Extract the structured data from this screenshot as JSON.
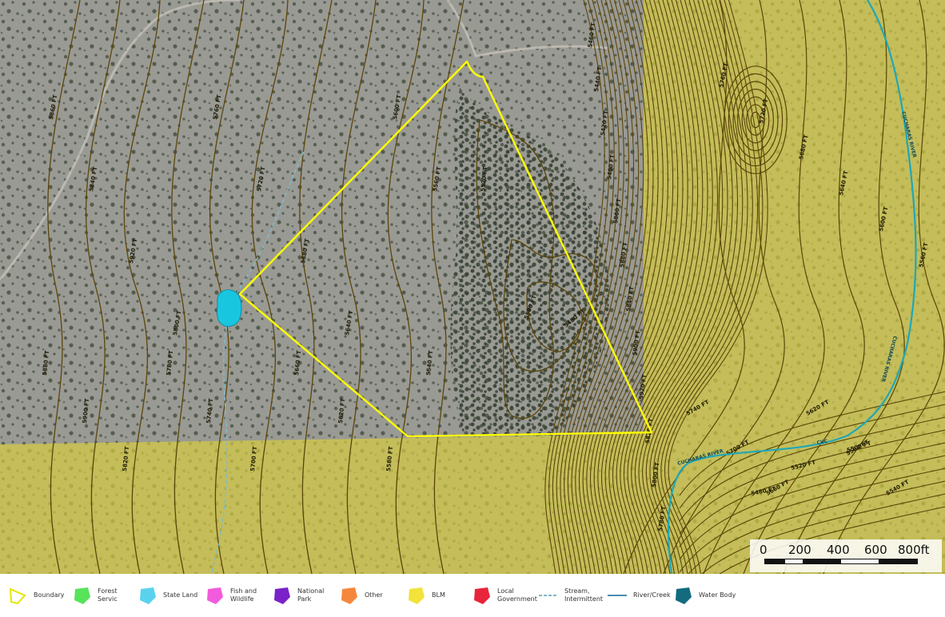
{
  "map": {
    "boundary_color": "#ffff00",
    "blm_overlay_color": "#d9cf3f",
    "contour_color": "#5b4508",
    "water_body_color": "#19c6e0",
    "river_color": "#1fa7b8",
    "contour_labels": [
      "5860 FT",
      "5880 FT",
      "5840 FT",
      "5900 FT",
      "5920 FT",
      "5820 FT",
      "5800 FT",
      "5780 FT",
      "5760 FT",
      "5740 FT",
      "5720 FT",
      "5700 FT",
      "5680 FT",
      "5660 FT",
      "5640 FT",
      "5620 FT",
      "5600 FT",
      "5580 FT",
      "5560 FT",
      "5540 FT",
      "5520 FT",
      "5500 FT",
      "5480 FT",
      "5460 FT",
      "5440 FT",
      "5420 FT",
      "5400 FT"
    ],
    "river_labels": [
      "CUCHARAS RIVER",
      "CUCHARAS RIVER",
      "CUC"
    ]
  },
  "scale": {
    "ticks": [
      "0",
      "200",
      "400",
      "600",
      "800ft"
    ]
  },
  "legend": {
    "items": [
      {
        "label": "Boundary",
        "icon": "boundary-outline-icon",
        "color": "#e6e600"
      },
      {
        "label": "Forest Servic",
        "icon": "forest-service-icon",
        "color": "#57e35a"
      },
      {
        "label": "State Land",
        "icon": "state-land-icon",
        "color": "#5ad2ee"
      },
      {
        "label": "Fish and\nWildlife",
        "icon": "fish-wildlife-icon",
        "color": "#f25bdc"
      },
      {
        "label": "National Park",
        "icon": "national-park-icon",
        "color": "#7a22c9"
      },
      {
        "label": "Other",
        "icon": "other-land-icon",
        "color": "#f5873c"
      },
      {
        "label": "BLM",
        "icon": "blm-icon",
        "color": "#f2e23a"
      },
      {
        "label": "Local\nGovernment",
        "icon": "local-government-icon",
        "color": "#e8253a"
      },
      {
        "label": "Stream,\nIntermittent",
        "icon": "stream-intermittent-icon",
        "color": "#5ba0b6"
      },
      {
        "label": "River/Creek",
        "icon": "river-creek-icon",
        "color": "#4a8fb0"
      },
      {
        "label": "Water Body",
        "icon": "water-body-icon",
        "color": "#136b7f"
      }
    ]
  }
}
